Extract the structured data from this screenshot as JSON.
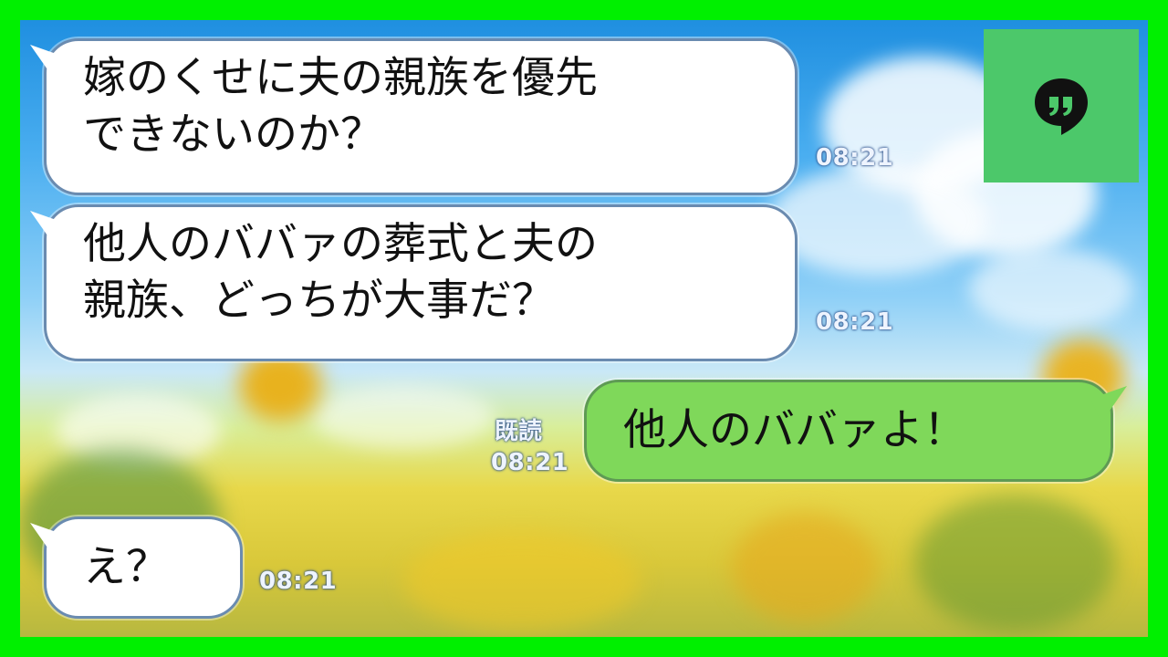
{
  "messages": [
    {
      "side": "in",
      "text": "嫁のくせに夫の親族を優先\nできないのか？",
      "time": "08:21"
    },
    {
      "side": "in",
      "text": "他人のババァの葬式と夫の\n親族、どっちが大事だ？",
      "time": "08:21"
    },
    {
      "side": "out",
      "text": "他人のババァよ！",
      "time": "08:21",
      "read": "既読"
    },
    {
      "side": "in",
      "text": "え？",
      "time": "08:21"
    }
  ],
  "app_icon": {
    "name": "chat-quote-icon",
    "bg_color": "#4cc86a"
  },
  "colors": {
    "frame": "#00f000",
    "incoming": "#ffffff",
    "outgoing": "#7fd85a"
  }
}
